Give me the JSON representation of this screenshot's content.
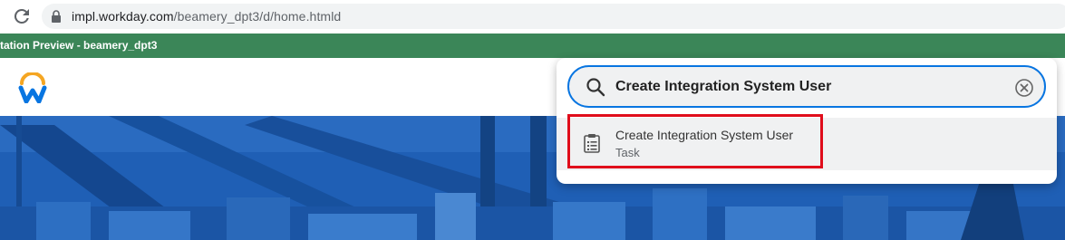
{
  "browser": {
    "url_host": "impl.workday.com",
    "url_path": "/beamery_dpt3/d/home.htmld"
  },
  "banner": {
    "text": "tation Preview - beamery_dpt3"
  },
  "header": {
    "logo": "workday-logo-icon"
  },
  "search": {
    "query": "Create Integration System User",
    "icons": [
      "search-icon",
      "clear-icon"
    ]
  },
  "results": [
    {
      "title": "Create Integration System User",
      "type": "Task",
      "icon": "task-clipboard-icon",
      "highlight_color": "#e00d1b"
    }
  ],
  "colors": {
    "banner": "#3b8658",
    "hero": "#1a5bb0",
    "search_border": "#0875e1",
    "highlight": "#e00d1b"
  }
}
